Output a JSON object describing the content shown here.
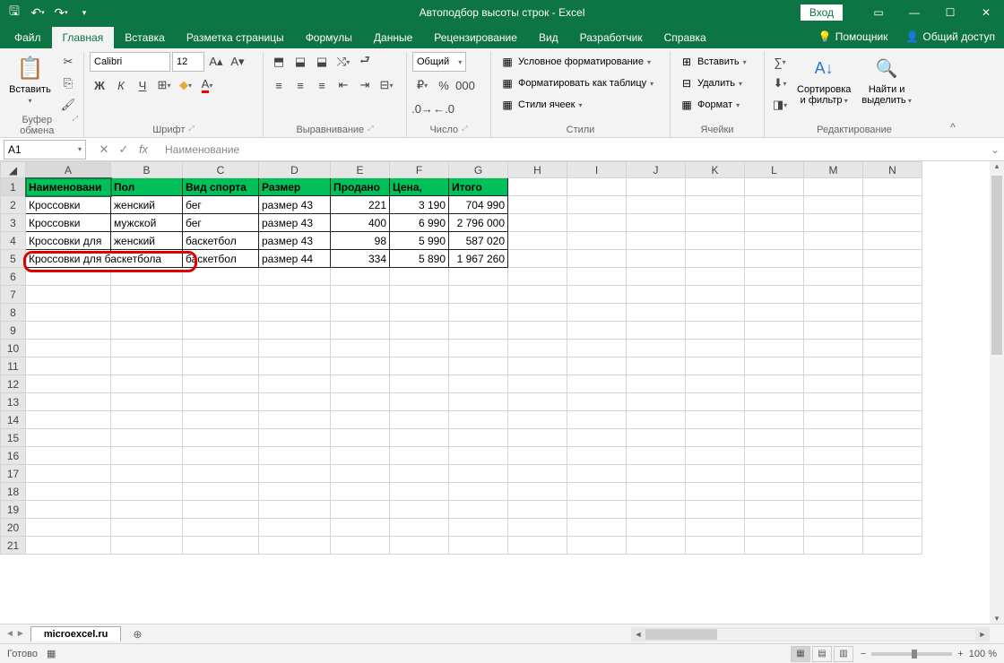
{
  "title": "Автоподбор высоты строк - Excel",
  "signin": "Вход",
  "tabs": {
    "file": "Файл",
    "home": "Главная",
    "insert": "Вставка",
    "layout": "Разметка страницы",
    "formulas": "Формулы",
    "data": "Данные",
    "review": "Рецензирование",
    "view": "Вид",
    "developer": "Разработчик",
    "help": "Справка",
    "tellme": "Помощник",
    "share": "Общий доступ"
  },
  "ribbon": {
    "clipboard": {
      "label": "Буфер обмена",
      "paste": "Вставить"
    },
    "font": {
      "label": "Шрифт",
      "name": "Calibri",
      "size": "12",
      "bold": "Ж",
      "italic": "К",
      "underline": "Ч"
    },
    "alignment": {
      "label": "Выравнивание"
    },
    "number": {
      "label": "Число",
      "format": "Общий"
    },
    "styles": {
      "label": "Стили",
      "condfmt": "Условное форматирование",
      "astable": "Форматировать как таблицу",
      "cellstyles": "Стили ячеек"
    },
    "cells": {
      "label": "Ячейки",
      "insert": "Вставить",
      "delete": "Удалить",
      "format": "Формат"
    },
    "editing": {
      "label": "Редактирование",
      "sortfilter": "Сортировка\nи фильтр",
      "findselect": "Найти и\nвыделить"
    }
  },
  "namebox": "A1",
  "formula": "Наименование",
  "headers": {
    "cols": [
      "A",
      "B",
      "C",
      "D",
      "E",
      "F",
      "G",
      "H",
      "I",
      "J",
      "K",
      "L",
      "M",
      "N"
    ],
    "rows": [
      "1",
      "2",
      "3",
      "4",
      "5",
      "6",
      "7",
      "8",
      "9",
      "10",
      "11",
      "12",
      "13",
      "14",
      "15",
      "16",
      "17",
      "18",
      "19",
      "20",
      "21"
    ]
  },
  "data_headers": [
    "Наименовани",
    "Пол",
    "Вид спорта",
    "Размер",
    "Продано",
    "Цена,",
    "Итого"
  ],
  "rows": [
    [
      "Кроссовки",
      "женский",
      "бег",
      "размер 43",
      "221",
      "3 190",
      "704 990"
    ],
    [
      "Кроссовки",
      "мужской",
      "бег",
      "размер 43",
      "400",
      "6 990",
      "2 796 000"
    ],
    [
      "Кроссовки для",
      "женский",
      "баскетбол",
      "размер 43",
      "98",
      "5 990",
      "587 020"
    ],
    [
      "Кроссовки для баскетбола",
      "",
      "баскетбол",
      "размер 44",
      "334",
      "5 890",
      "1 967 260"
    ]
  ],
  "overflow_text": "Кроссовки для баскетбола",
  "sheet_tab": "microexcel.ru",
  "status": {
    "ready": "Готово",
    "zoom": "100 %"
  }
}
